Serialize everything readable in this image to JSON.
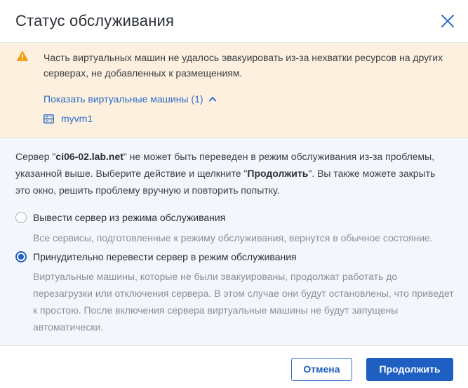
{
  "dialog": {
    "title": "Статус обслуживания",
    "close_icon": "close-icon"
  },
  "warning": {
    "icon": "warning-triangle-icon",
    "icon_color": "#f39c12",
    "message": "Часть виртуальных машин не удалось эвакуировать из-за нехватки ресурсов на других серверах, не добавленных к размещениям.",
    "toggle_label": "Показать виртуальные машины (1)",
    "toggle_state": "expanded",
    "vms": [
      {
        "name": "myvm1",
        "icon": "server-icon"
      }
    ]
  },
  "body": {
    "desc_prefix": "Сервер \"",
    "server_name": "ci06-02.lab.net",
    "desc_middle": "\" не может быть переведен в режим обслуживания из-за проблемы, указанной выше. Выберите действие и щелкните \"",
    "desc_action": "Продолжить",
    "desc_suffix": "\". Вы также можете закрыть это окно, решить проблему вручную и повторить попытку.",
    "options": [
      {
        "label": "Вывести сервер из режима обслуживания",
        "hint": "Все сервисы, подготовленные к режиму обслуживания, вернутся в обычное состояние.",
        "checked": false
      },
      {
        "label": "Принудительно перевести сервер в режим обслуживания",
        "hint": "Виртуальные машины, которые не были эвакуированы, продолжат работать до перезагрузки или отключения сервера. В этом случае они будут остановлены, что приведет к простою. После включения сервера виртуальные машины не будут запущены автоматически.",
        "checked": true
      }
    ]
  },
  "footer": {
    "cancel_label": "Отмена",
    "continue_label": "Продолжить"
  },
  "colors": {
    "accent": "#1e5fc1",
    "link": "#2d6ec9",
    "warning_bg": "#fdf0de",
    "body_bg": "#f3f6fa"
  }
}
